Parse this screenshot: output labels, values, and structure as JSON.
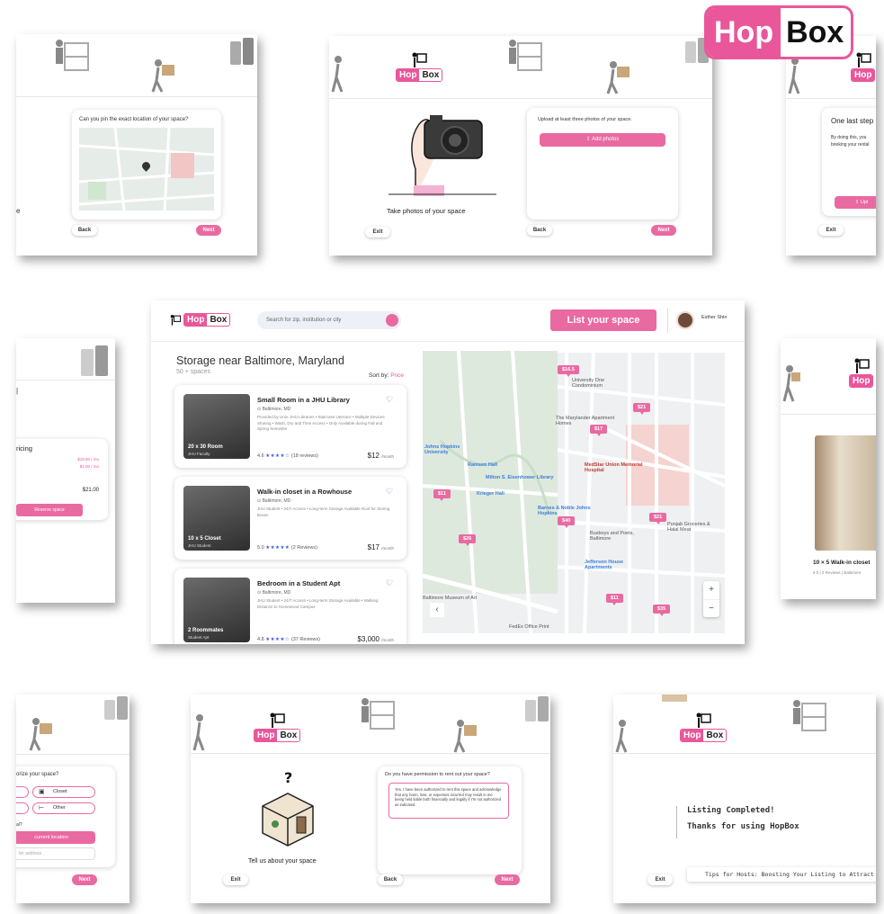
{
  "brand": {
    "hop": "Hop",
    "box": "Box",
    "accent": "#e9579a"
  },
  "screen_pin": {
    "question": "Can you pin the exact location of your space?",
    "side_fragment": "e",
    "back": "Back",
    "next": "Next"
  },
  "screen_photos": {
    "instruction": "Upload at least three photos of your space.",
    "add_photos": "Add photos",
    "caption": "Take photos of your space",
    "exit": "Exit",
    "back": "Back",
    "next": "Next"
  },
  "screen_last": {
    "title": "One last step",
    "line1": "By doing this, you",
    "line2": "booking your rental",
    "upload": "Upl",
    "exit": "Exit"
  },
  "main": {
    "search_placeholder": "Search for zip, institution or city",
    "list_space": "List your space",
    "user_name": "Esther Shin",
    "heading": "Storage near Baltimore, Maryland",
    "count": "50 + spaces",
    "sort_label": "Sort by:",
    "sort_value": "Price",
    "listings": [
      {
        "title": "Small Room in a JHU Library",
        "location": "Baltimore, MD",
        "desc": "Provided by Univ. JHU Libraries • Staircase Uterrace • Multiple Devices Sharing • Wash, Dry and Time Access • Only Available during Fall and Spring Semester",
        "thumb_caption": "20 x 30 Room",
        "thumb_sub": "JHU Faculty",
        "rating": "4.6",
        "stars": "★★★★☆",
        "reviews": "(18 reviews)",
        "price": "$12",
        "unit": "/month"
      },
      {
        "title": "Walk-in closet in a Rowhouse",
        "location": "Baltimore, MD",
        "desc": "JHU Student • 24/7 Access • Long-term Storage Available Roof for Storing Boxes",
        "thumb_caption": "10 x 5 Closet",
        "thumb_sub": "JHU Student",
        "rating": "5.0",
        "stars": "★★★★★",
        "reviews": "(2 Reviews)",
        "price": "$17",
        "unit": "/month"
      },
      {
        "title": "Bedroom in a Student Apt",
        "location": "Baltimore, MD",
        "desc": "JHU Student • 24/7 Access • Long-term Storage Available • Walking Distance to Homewood Campus",
        "thumb_caption": "2 Roommates",
        "thumb_sub": "Student Apt",
        "rating": "4.8",
        "stars": "★★★★☆",
        "reviews": "(37 Reviews)",
        "price": "$3,000",
        "unit": "/month"
      }
    ],
    "map_labels": {
      "jhu": "Johns Hopkins University",
      "roman": "Ramsen Hall",
      "eisenhower": "Milton S. Eisenhower Library",
      "krieger": "Krieger Hall",
      "medstar": "MedStar Union Memorial Hospital",
      "maryland": "The Marylander Apartment Homes",
      "univone": "University One Condominium",
      "barnes": "Barnes & Noble Johns Hopkins",
      "busboys": "Busboys and Poets, Baltimore",
      "jefferson": "Jefferson House Apartments",
      "punjab": "Punjab Groceries & Halal Meat",
      "museum": "Baltimore Museum of Art",
      "fedex": "FedEx Office Print"
    },
    "pins": [
      "$16.5",
      "$21",
      "$17",
      "$11",
      "$40",
      "$21",
      "$26",
      "$11",
      "$35"
    ],
    "zoom_in": "+",
    "zoom_out": "−"
  },
  "screen_pricing": {
    "frag": "ricing",
    "row1": "$19.50 / mo",
    "row2": "$4.00 / mo",
    "total": "$21.00",
    "reserve": "Reserve space"
  },
  "screen_closet": {
    "title": "10 × 5 Walk-in closet",
    "meta": "5.0 | 2 Reviews | Baltimore"
  },
  "screen_categorize": {
    "question": "orize your space?",
    "closet": "Closet",
    "other": "Other",
    "frag": "al?",
    "current_location": "current location",
    "address": "ter address",
    "next": "Next"
  },
  "screen_permission": {
    "question": "Do you have permission to rent out your space?",
    "answer": "Yes, I have been authorized to rent this space and acknowledge that any harm, loss, or expenses incurred may result in me being held liable both financially and legally if I'm not authorized as indicated.",
    "caption": "Tell us about your space",
    "exit": "Exit",
    "back": "Back",
    "next": "Next"
  },
  "screen_done": {
    "line1": "Listing Completed!",
    "line2": "Thanks for using HopBox",
    "tips": "Tips for Hosts: Boosting Your Listing to Attract Re",
    "exit": "Exit"
  }
}
